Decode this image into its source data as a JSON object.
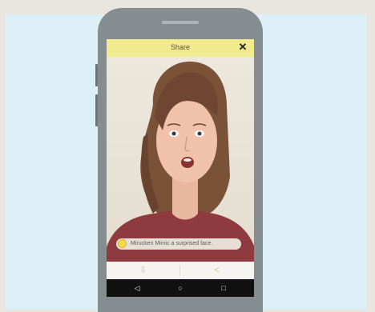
{
  "header": {
    "title": "Share",
    "close_glyph": "✕"
  },
  "photo": {
    "caption": "Mirucken Mimic a surprised face.",
    "caption_icon": "emoji-icon"
  },
  "actions": {
    "download_glyph": "⇩",
    "share_glyph": "<"
  },
  "navbar": {
    "back_glyph": "◁",
    "home_glyph": "○",
    "recents_glyph": "□"
  },
  "colors": {
    "header_bg": "#f2ea8e",
    "scene_bg": "#dceff6",
    "phone_frame": "#858d91",
    "nav_bg": "#111111"
  }
}
